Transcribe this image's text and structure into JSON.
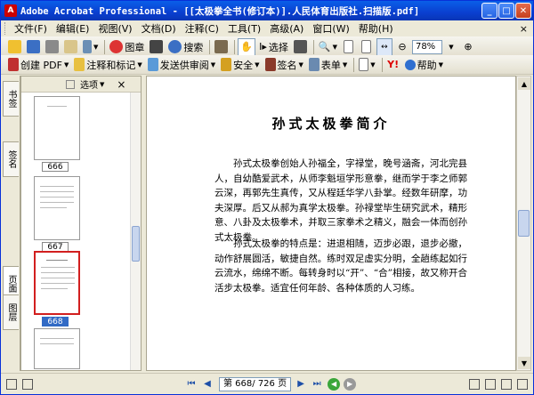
{
  "window": {
    "title": "Adobe Acrobat Professional - [[太极拳全书(修订本)].人民体育出版社.扫描版.pdf]"
  },
  "menu": {
    "items": [
      "文件(F)",
      "编辑(E)",
      "视图(V)",
      "文档(D)",
      "注释(C)",
      "工具(T)",
      "高级(A)",
      "窗口(W)",
      "帮助(H)"
    ],
    "close_label": "×"
  },
  "toolbar1": {
    "pictures_label": "图章",
    "search_label": "搜索",
    "select_label": "选择",
    "zoom_value": "78%"
  },
  "toolbar2": {
    "create_pdf_label": "创建 PDF",
    "comment_label": "注释和标记",
    "review_label": "发送供审阅",
    "security_label": "安全",
    "sign_label": "签名",
    "forms_label": "表单",
    "help_label": "帮助"
  },
  "left_tabs": {
    "bookmarks": "书签",
    "signatures": "签名",
    "pages": "页面",
    "layers": "图层"
  },
  "panel": {
    "options_label": "选项",
    "close_label": "×"
  },
  "thumbnails": [
    {
      "label": "666",
      "selected": false
    },
    {
      "label": "667",
      "selected": false
    },
    {
      "label": "668",
      "selected": true
    }
  ],
  "document": {
    "title": "孙式太极拳简介",
    "paragraph1": "孙式太极拳创始人孙福全，字禄堂，晚号涵斋，河北完县人，自幼酷爱武术，从师李魁垣学形意拳，继而学于李之师郭云深，再郭先生真传，又从程廷华学八卦掌。经数年研摩，功夫深厚。后又从郝为真学太极拳。孙禄堂毕生研究武术，精形意、八卦及太极拳术，并取三家拳术之精义，融会一体而创孙式太极拳。",
    "paragraph2": "孙式太极拳的特点是：进退相随，迈步必跟，退步必撤，动作舒展圆活，敏捷自然。练时双足虚实分明，全趟练起如行云流水，绵绵不断。每转身时以“开”、“合”相接，故又称开合活步太极拳。适宜任何年龄、各种体质的人习练。"
  },
  "statusbar": {
    "page_current": "第 668",
    "page_total": "/ 726 页"
  }
}
